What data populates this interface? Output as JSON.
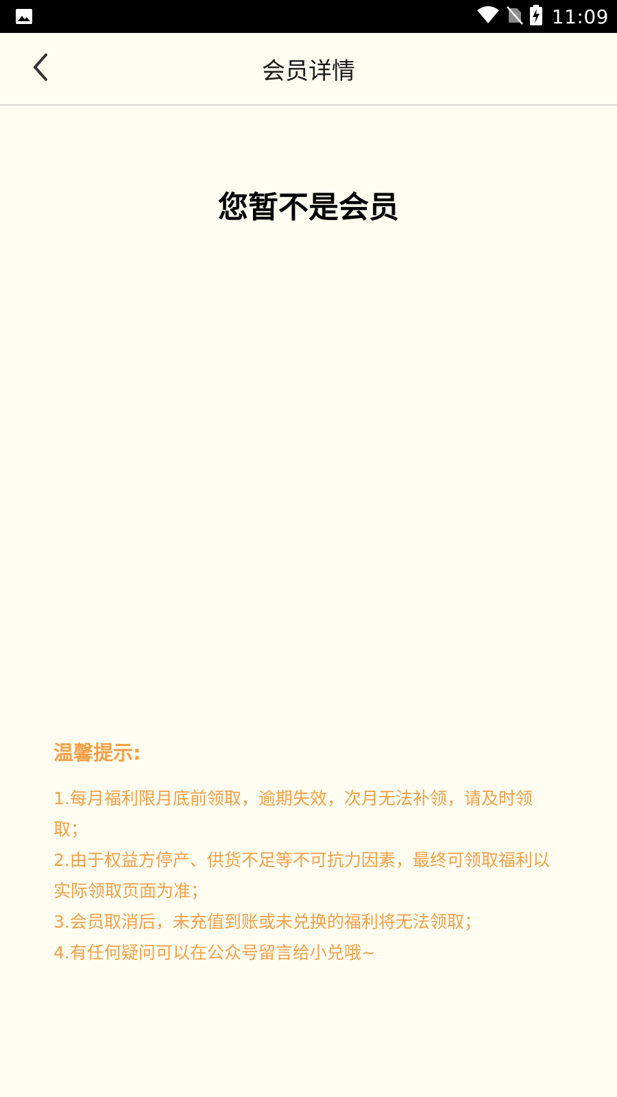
{
  "status_bar": {
    "time": "11:09",
    "icons": [
      "gallery-icon",
      "wifi-icon",
      "no-sim-icon",
      "battery-charging-icon"
    ]
  },
  "app_bar": {
    "title": "会员详情",
    "back_icon": "chevron-left-icon"
  },
  "main": {
    "status_message": "您暂不是会员"
  },
  "tips": {
    "title": "温馨提示:",
    "items": [
      "1.每月福利限月底前领取，逾期失效，次月无法补领，请及时领取；",
      "2.由于权益方停产、供货不足等不可抗力因素，最终可领取福利以实际领取页面为准；",
      "3.会员取消后，未充值到账或未兑换的福利将无法领取；",
      "4.有任何疑问可以在公众号留言给小兑哦~"
    ]
  },
  "colors": {
    "background": "#fffdf1",
    "status_bar": "#000000",
    "tips_text": "#f4a047",
    "title_text": "#1a1a1a"
  }
}
